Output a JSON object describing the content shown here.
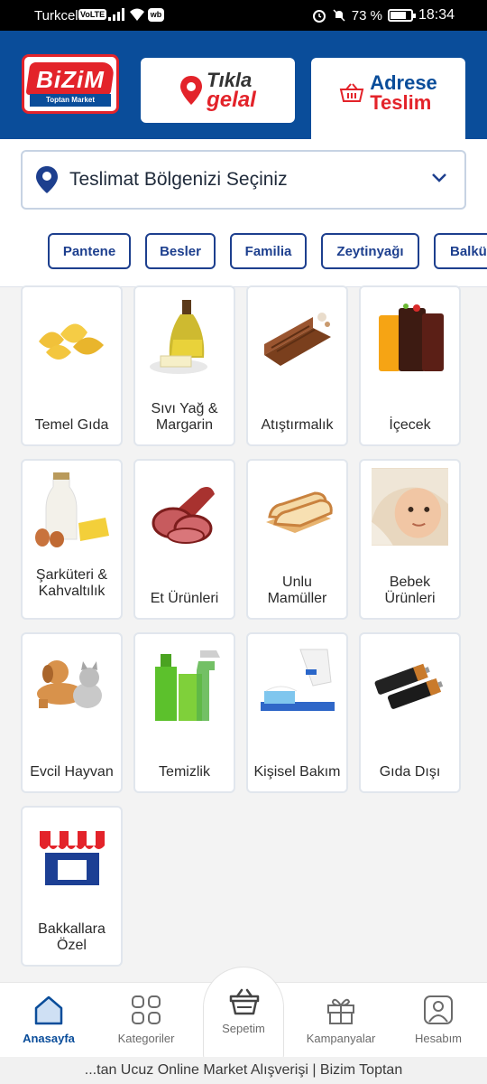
{
  "status_bar": {
    "carrier": "Turkcell",
    "volte": "VoLTE",
    "wb": "wb",
    "battery": "73 %",
    "time": "18:34"
  },
  "header": {
    "logo_text": "BiZiM",
    "logo_sub": "Toptan Market",
    "tikla_line1": "Tıkla",
    "tikla_line2": "gelal",
    "adrese_line1": "Adrese",
    "adrese_line2": "Teslim"
  },
  "region": {
    "label": "Teslimat Bölgenizi Seçiniz"
  },
  "chips": [
    "Pantene",
    "Besler",
    "Familia",
    "Zeytinyağı",
    "Balküpü"
  ],
  "categories": [
    {
      "name": "Temel Gıda",
      "icon": "pasta-icon"
    },
    {
      "name": "Sıvı Yağ & Margarin",
      "icon": "oil-bottle-icon"
    },
    {
      "name": "Atıştırmalık",
      "icon": "wafer-icon"
    },
    {
      "name": "İçecek",
      "icon": "drinks-icon"
    },
    {
      "name": "Şarküteri & Kahvaltılık",
      "icon": "breakfast-icon"
    },
    {
      "name": "Et Ürünleri",
      "icon": "salami-icon"
    },
    {
      "name": "Unlu Mamüller",
      "icon": "bread-icon"
    },
    {
      "name": "Bebek Ürünleri",
      "icon": "baby-icon"
    },
    {
      "name": "Evcil Hayvan",
      "icon": "pets-icon"
    },
    {
      "name": "Temizlik",
      "icon": "cleaning-bottles-icon"
    },
    {
      "name": "Kişisel Bakım",
      "icon": "toothbrush-icon"
    },
    {
      "name": "Gıda Dışı",
      "icon": "batteries-icon"
    },
    {
      "name": "Bakkallara Özel",
      "icon": "storefront-icon"
    }
  ],
  "nav": {
    "home": "Anasayfa",
    "categories": "Kategoriler",
    "cart": "Sepetim",
    "campaigns": "Kampanyalar",
    "account": "Hesabım"
  },
  "footer": {
    "title": "...tan Ucuz Online Market Alışverişi | Bizim Toptan"
  },
  "colors": {
    "brand_blue": "#0a4d9a",
    "brand_red": "#e3232a",
    "chip_blue": "#1d3f8e"
  }
}
